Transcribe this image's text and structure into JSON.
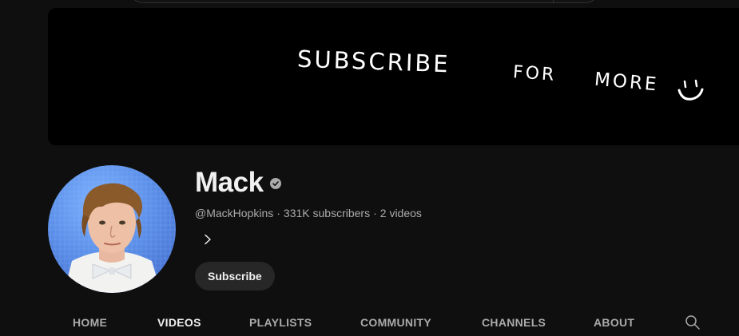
{
  "banner": {
    "word1": "SUBSCRIBE",
    "word2": "FOR",
    "word3": "MORE"
  },
  "channel": {
    "name": "Mack",
    "handle": "@MackHopkins",
    "separator1": "·",
    "subscribers": "331K subscribers",
    "separator2": "·",
    "video_count": "2 videos"
  },
  "actions": {
    "subscribe_label": "Subscribe"
  },
  "tabs": [
    {
      "label": "HOME",
      "active": false
    },
    {
      "label": "VIDEOS",
      "active": true
    },
    {
      "label": "PLAYLISTS",
      "active": false
    },
    {
      "label": "COMMUNITY",
      "active": false
    },
    {
      "label": "CHANNELS",
      "active": false
    },
    {
      "label": "ABOUT",
      "active": false
    }
  ],
  "icons": {
    "verified": "verified-check-icon",
    "chevron": "chevron-right-icon",
    "search": "search-icon",
    "smiley": "smiley-face-icon"
  },
  "colors": {
    "background": "#0f0f0f",
    "text_primary": "#f1f1f1",
    "text_secondary": "#aaaaaa",
    "button_bg": "#272727",
    "banner_bg": "#000000"
  }
}
